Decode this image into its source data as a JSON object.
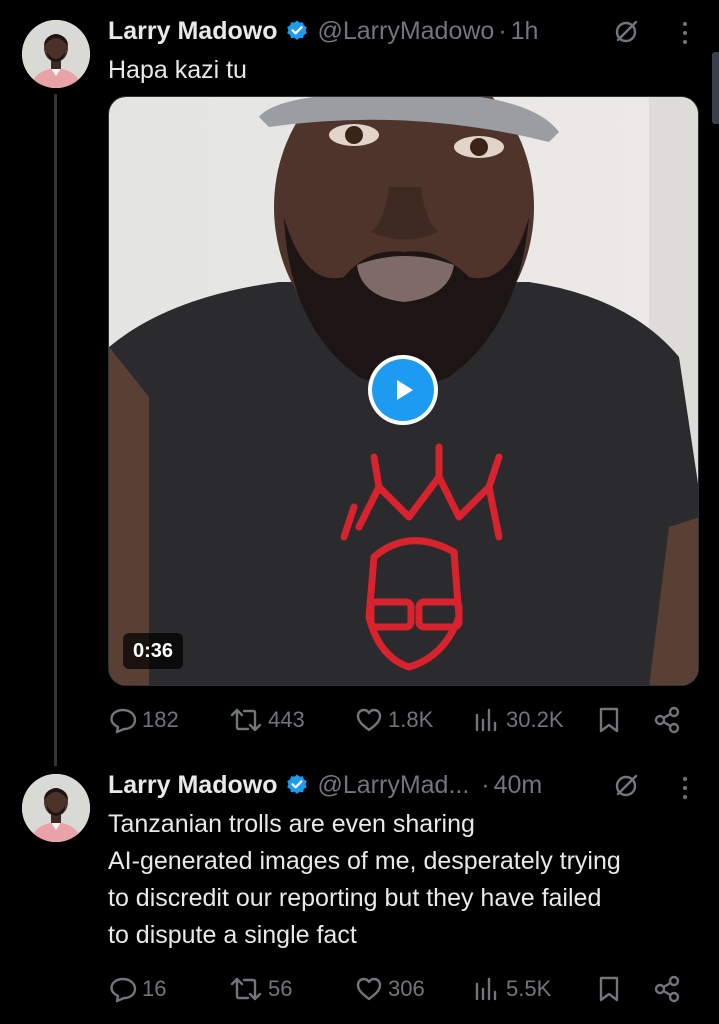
{
  "tweets": [
    {
      "author_name": "Larry Madowo",
      "handle": "@LarryMadowo",
      "time": "1h",
      "text": "Hapa kazi tu",
      "video_duration": "0:36",
      "stats": {
        "replies": "182",
        "reposts": "443",
        "likes": "1.8K",
        "views": "30.2K"
      }
    },
    {
      "author_name": "Larry Madowo",
      "handle": "@LarryMad...",
      "time": "40m",
      "text_lines": [
        "Tanzanian trolls are even sharing",
        "AI-generated images of me, desperately trying",
        "to discredit our reporting but they have failed",
        "to dispute a single fact"
      ],
      "stats": {
        "replies": "16",
        "reposts": "56",
        "likes": "306",
        "views": "5.5K"
      }
    }
  ],
  "separator": "·",
  "colors": {
    "background": "#000000",
    "text": "#e7e9ea",
    "muted": "#71767b",
    "accent": "#1d9bf0",
    "thread_line": "#333639"
  },
  "icons": [
    "verified-badge-icon",
    "grok-icon",
    "more-icon",
    "play-icon",
    "reply-icon",
    "repost-icon",
    "like-icon",
    "views-icon",
    "bookmark-icon",
    "share-icon"
  ]
}
